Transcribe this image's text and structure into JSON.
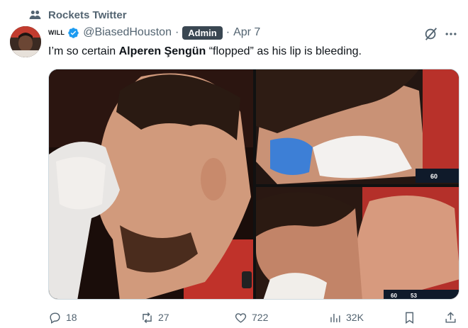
{
  "context": {
    "label": "Rockets Twitter",
    "icon": "community-icon"
  },
  "tweet": {
    "author": {
      "name": "WILL",
      "handle": "@BiasedHouston",
      "verified": true,
      "badge": "Admin"
    },
    "date": "Apr 7",
    "text": {
      "before": "I’m so certain ",
      "bold": "Alperen Şengün",
      "after": " “flopped” as his lip is bleeding."
    },
    "media": {
      "count": 3,
      "scoreboard": [
        "60",
        "53"
      ]
    },
    "metrics": {
      "replies": "18",
      "reposts": "27",
      "likes": "722",
      "views": "32K"
    }
  },
  "colors": {
    "text": "#0f1419",
    "secondary": "#536471",
    "verified": "#1d9bf0",
    "badge": "#3a4752",
    "border": "#cfd9de"
  }
}
